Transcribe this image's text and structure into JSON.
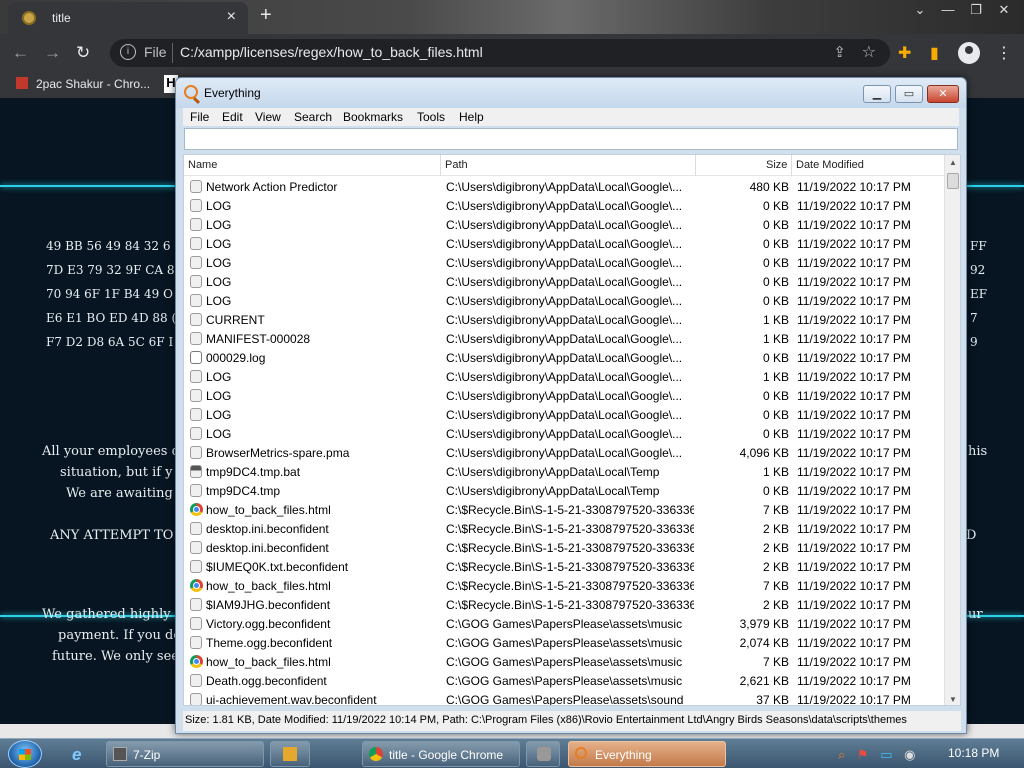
{
  "browser": {
    "tab_title": "title",
    "tab_close": "×",
    "new_tab": "+",
    "file_label": "File",
    "url": "C:/xampp/licenses/regex/how_to_back_files.html",
    "bookmarks": [
      {
        "label": "2pac Shakur - Chro..."
      },
      {
        "label": "H"
      }
    ]
  },
  "webpage": {
    "hex_left": [
      "49 BB 56 49 84 32 6",
      "7D E3 79 32 9F CA 8",
      "70 94 6F 1F B4 49 O",
      "E6 E1 BO ED 4D 88 (",
      "F7 D2 D8 6A 5C 6F I"
    ],
    "hex_right": [
      "FF",
      "92",
      "EF",
      "7",
      "9"
    ],
    "para1_lines": [
      "All your employees d",
      "situation, but if y",
      "We are awaiting f"
    ],
    "para1_right": "his",
    "para2_line": "ANY ATTEMPT TO R",
    "para2_right": "D",
    "para3_lines": [
      "We gathered highly c",
      "payment. If you dec",
      "future. We only see"
    ],
    "para3_right": "ur"
  },
  "everything": {
    "title": "Everything",
    "menu": [
      "File",
      "Edit",
      "View",
      "Search",
      "Bookmarks",
      "Tools",
      "Help"
    ],
    "search_value": "",
    "columns": {
      "name": "Name",
      "path": "Path",
      "size": "Size",
      "date": "Date Modified"
    },
    "rows": [
      {
        "name": "Network Action Predictor",
        "path": "C:\\Users\\digibrony\\AppData\\Local\\Google\\...",
        "size": "480 KB",
        "date": "11/19/2022 10:17 PM",
        "icon": "file"
      },
      {
        "name": "LOG",
        "path": "C:\\Users\\digibrony\\AppData\\Local\\Google\\...",
        "size": "0 KB",
        "date": "11/19/2022 10:17 PM",
        "icon": "file"
      },
      {
        "name": "LOG",
        "path": "C:\\Users\\digibrony\\AppData\\Local\\Google\\...",
        "size": "0 KB",
        "date": "11/19/2022 10:17 PM",
        "icon": "file"
      },
      {
        "name": "LOG",
        "path": "C:\\Users\\digibrony\\AppData\\Local\\Google\\...",
        "size": "0 KB",
        "date": "11/19/2022 10:17 PM",
        "icon": "file"
      },
      {
        "name": "LOG",
        "path": "C:\\Users\\digibrony\\AppData\\Local\\Google\\...",
        "size": "0 KB",
        "date": "11/19/2022 10:17 PM",
        "icon": "file"
      },
      {
        "name": "LOG",
        "path": "C:\\Users\\digibrony\\AppData\\Local\\Google\\...",
        "size": "0 KB",
        "date": "11/19/2022 10:17 PM",
        "icon": "file"
      },
      {
        "name": "LOG",
        "path": "C:\\Users\\digibrony\\AppData\\Local\\Google\\...",
        "size": "0 KB",
        "date": "11/19/2022 10:17 PM",
        "icon": "file"
      },
      {
        "name": "CURRENT",
        "path": "C:\\Users\\digibrony\\AppData\\Local\\Google\\...",
        "size": "1 KB",
        "date": "11/19/2022 10:17 PM",
        "icon": "file"
      },
      {
        "name": "MANIFEST-000028",
        "path": "C:\\Users\\digibrony\\AppData\\Local\\Google\\...",
        "size": "1 KB",
        "date": "11/19/2022 10:17 PM",
        "icon": "file"
      },
      {
        "name": "000029.log",
        "path": "C:\\Users\\digibrony\\AppData\\Local\\Google\\...",
        "size": "0 KB",
        "date": "11/19/2022 10:17 PM",
        "icon": "log"
      },
      {
        "name": "LOG",
        "path": "C:\\Users\\digibrony\\AppData\\Local\\Google\\...",
        "size": "1 KB",
        "date": "11/19/2022 10:17 PM",
        "icon": "file"
      },
      {
        "name": "LOG",
        "path": "C:\\Users\\digibrony\\AppData\\Local\\Google\\...",
        "size": "0 KB",
        "date": "11/19/2022 10:17 PM",
        "icon": "file"
      },
      {
        "name": "LOG",
        "path": "C:\\Users\\digibrony\\AppData\\Local\\Google\\...",
        "size": "0 KB",
        "date": "11/19/2022 10:17 PM",
        "icon": "file"
      },
      {
        "name": "LOG",
        "path": "C:\\Users\\digibrony\\AppData\\Local\\Google\\...",
        "size": "0 KB",
        "date": "11/19/2022 10:17 PM",
        "icon": "file"
      },
      {
        "name": "BrowserMetrics-spare.pma",
        "path": "C:\\Users\\digibrony\\AppData\\Local\\Google\\...",
        "size": "4,096 KB",
        "date": "11/19/2022 10:17 PM",
        "icon": "file"
      },
      {
        "name": "tmp9DC4.tmp.bat",
        "path": "C:\\Users\\digibrony\\AppData\\Local\\Temp",
        "size": "1 KB",
        "date": "11/19/2022 10:17 PM",
        "icon": "bat"
      },
      {
        "name": "tmp9DC4.tmp",
        "path": "C:\\Users\\digibrony\\AppData\\Local\\Temp",
        "size": "0 KB",
        "date": "11/19/2022 10:17 PM",
        "icon": "file"
      },
      {
        "name": "how_to_back_files.html",
        "path": "C:\\$Recycle.Bin\\S-1-5-21-3308797520-336336...",
        "size": "7 KB",
        "date": "11/19/2022 10:17 PM",
        "icon": "chrome"
      },
      {
        "name": "desktop.ini.beconfident",
        "path": "C:\\$Recycle.Bin\\S-1-5-21-3308797520-336336...",
        "size": "2 KB",
        "date": "11/19/2022 10:17 PM",
        "icon": "file"
      },
      {
        "name": "desktop.ini.beconfident",
        "path": "C:\\$Recycle.Bin\\S-1-5-21-3308797520-336336...",
        "size": "2 KB",
        "date": "11/19/2022 10:17 PM",
        "icon": "file"
      },
      {
        "name": "$IUMEQ0K.txt.beconfident",
        "path": "C:\\$Recycle.Bin\\S-1-5-21-3308797520-336336...",
        "size": "2 KB",
        "date": "11/19/2022 10:17 PM",
        "icon": "file"
      },
      {
        "name": "how_to_back_files.html",
        "path": "C:\\$Recycle.Bin\\S-1-5-21-3308797520-336336...",
        "size": "7 KB",
        "date": "11/19/2022 10:17 PM",
        "icon": "chrome"
      },
      {
        "name": "$IAM9JHG.beconfident",
        "path": "C:\\$Recycle.Bin\\S-1-5-21-3308797520-336336...",
        "size": "2 KB",
        "date": "11/19/2022 10:17 PM",
        "icon": "file"
      },
      {
        "name": "Victory.ogg.beconfident",
        "path": "C:\\GOG Games\\PapersPlease\\assets\\music",
        "size": "3,979 KB",
        "date": "11/19/2022 10:17 PM",
        "icon": "file"
      },
      {
        "name": "Theme.ogg.beconfident",
        "path": "C:\\GOG Games\\PapersPlease\\assets\\music",
        "size": "2,074 KB",
        "date": "11/19/2022 10:17 PM",
        "icon": "file"
      },
      {
        "name": "how_to_back_files.html",
        "path": "C:\\GOG Games\\PapersPlease\\assets\\music",
        "size": "7 KB",
        "date": "11/19/2022 10:17 PM",
        "icon": "chrome"
      },
      {
        "name": "Death.ogg.beconfident",
        "path": "C:\\GOG Games\\PapersPlease\\assets\\music",
        "size": "2,621 KB",
        "date": "11/19/2022 10:17 PM",
        "icon": "file"
      },
      {
        "name": "ui-achievement.wav.beconfident",
        "path": "C:\\GOG Games\\PapersPlease\\assets\\sound",
        "size": "37 KB",
        "date": "11/19/2022 10:17 PM",
        "icon": "file"
      }
    ],
    "status": "Size: 1.81 KB, Date Modified: 11/19/2022 10:14 PM, Path: C:\\Program Files (x86)\\Rovio Entertainment Ltd\\Angry Birds Seasons\\data\\scripts\\themes"
  },
  "taskbar": {
    "tasks": [
      {
        "label": "7-Zip"
      },
      {
        "label": ""
      },
      {
        "label": "title - Google Chrome"
      },
      {
        "label": ""
      },
      {
        "label": "Everything"
      }
    ],
    "clock": "10:18 PM"
  }
}
